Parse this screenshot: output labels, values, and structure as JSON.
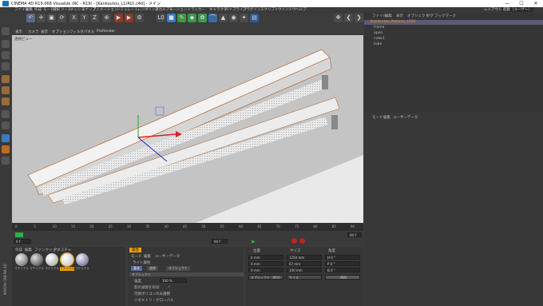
{
  "window": {
    "title": "CINEMA 4D R19.068 Visualize (RC - R19) - [Kankoutou_L1(RU).c4d] - メイン",
    "min_glyph": "—",
    "max_glyph": "☐",
    "close_glyph": "✕"
  },
  "menubar": {
    "items": [
      "ファイル",
      "編集",
      "作成",
      "モード",
      "選択",
      "ツール",
      "メッシュ",
      "スナップ",
      "アニメーション",
      "シミュレート",
      "レンダリング",
      "スカルプト",
      "モーショントラッカー",
      "キャラクタ",
      "パイプライン",
      "プラグイン",
      "スクリプト",
      "ウインドウ",
      "ヘルプ"
    ],
    "layout_label": "レイアウト:",
    "layout_value": "起動（ユーザー）"
  },
  "toolbar": {
    "x": "X",
    "y": "Y",
    "z": "Z",
    "frame_num": "L0"
  },
  "viewport": {
    "menu": [
      "表示",
      "カメラ",
      "表示",
      "オプション",
      "フィルタ",
      "パネル",
      "ProRender"
    ],
    "view_label": "透視ビュー"
  },
  "timeline": {
    "ticks": [
      "0",
      "5",
      "10",
      "15",
      "20",
      "25",
      "30",
      "35",
      "40",
      "45",
      "50",
      "55",
      "60",
      "65",
      "70",
      "75",
      "80",
      "85",
      "90"
    ],
    "start_frame": "0 F",
    "end_frame": "90 F",
    "current_frame": "90 F"
  },
  "materials": {
    "menu": [
      "作成",
      "編集",
      "ファンクション",
      "テクスチャ"
    ],
    "items": [
      "マテリアル",
      "マテリアル",
      "マテリアル",
      "マテリアル",
      "マテリアル"
    ],
    "brand": "MAXON CINEMA 4D"
  },
  "attributes": {
    "header": "属性",
    "menu": [
      "モード",
      "編集",
      "ユーザーデータ"
    ],
    "object_label": "ライト属性",
    "tabs": [
      "基本",
      "座標",
      "オブジェクト"
    ],
    "section": "オブジェクト",
    "fields": [
      {
        "label": "強度",
        "value": "100 %"
      },
      {
        "label": "影の減衰を有効",
        "value": "✓"
      },
      {
        "label": "可視ポリゴンのみ選択",
        "value": "✓"
      },
      {
        "label": "ジオメトリ・グローバル",
        "value": ""
      }
    ]
  },
  "coords": {
    "headers": [
      "位置",
      "サイズ",
      "角度"
    ],
    "rows": [
      {
        "axis": "X",
        "pos": "0 mm",
        "size": "1250 mm",
        "angle": "H 0 °"
      },
      {
        "axis": "Y",
        "pos": "0 mm",
        "size": "67 mm",
        "angle": "P 0 °"
      },
      {
        "axis": "Z",
        "pos": "0 mm",
        "size": "100 mm",
        "angle": "B 0 °"
      }
    ],
    "mode": "オブジェクト（相対）",
    "size_mode": "サイズ",
    "apply": "適用"
  },
  "objects": {
    "menu": [
      "ファイル",
      "編集",
      "表示",
      "オブジェクト",
      "タグ",
      "ブックマーク"
    ],
    "items": [
      {
        "name": "Kankoutou_Nakano_LED1",
        "selected": true,
        "indent": 0
      },
      {
        "name": "frame",
        "selected": false,
        "indent": 1
      },
      {
        "name": "open",
        "selected": false,
        "indent": 1
      },
      {
        "name": "cube1",
        "selected": false,
        "indent": 1
      },
      {
        "name": "tube",
        "selected": false,
        "indent": 1
      }
    ]
  },
  "attrmgr": {
    "menu": [
      "モード",
      "編集",
      "ユーザーデータ"
    ]
  },
  "colors": {
    "accent": "#f0a000",
    "selection": "#5a5a7a"
  }
}
